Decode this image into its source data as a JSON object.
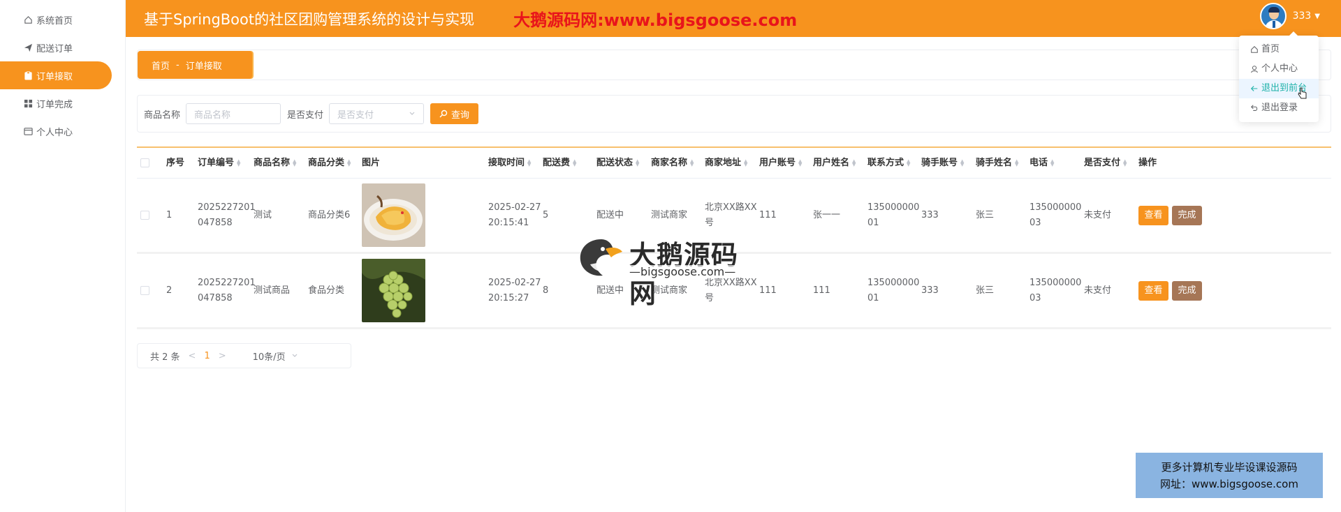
{
  "sidebar": {
    "items": [
      {
        "label": "系统首页",
        "icon": "home-icon"
      },
      {
        "label": "配送订单",
        "icon": "send-icon"
      },
      {
        "label": "订单接取",
        "icon": "clipboard-icon",
        "active": true
      },
      {
        "label": "订单完成",
        "icon": "grid-icon"
      },
      {
        "label": "个人中心",
        "icon": "card-icon"
      }
    ]
  },
  "header": {
    "title": "基于SpringBoot的社区团购管理系统的设计与实现",
    "watermark": "大鹅源码网:www.bigsgoose.com",
    "username": "333"
  },
  "dropdown": {
    "items": [
      "首页",
      "个人中心",
      "退出到前台",
      "退出登录"
    ]
  },
  "breadcrumb": {
    "home": "首页",
    "sep": "-",
    "current": "订单接取"
  },
  "search": {
    "name_label": "商品名称",
    "name_placeholder": "商品名称",
    "paid_label": "是否支付",
    "paid_placeholder": "是否支付",
    "button": "查询"
  },
  "table": {
    "columns": [
      "序号",
      "订单编号",
      "商品名称",
      "商品分类",
      "图片",
      "接取时间",
      "配送费",
      "配送状态",
      "商家名称",
      "商家地址",
      "用户账号",
      "用户姓名",
      "联系方式",
      "骑手账号",
      "骑手姓名",
      "电话",
      "是否支付",
      "操作"
    ],
    "rows": [
      {
        "idx": "1",
        "order_no_a": "2025227201",
        "order_no_b": "047858",
        "name": "测试",
        "category": "商品分类6",
        "image": "pasta-photo",
        "time_a": "2025-02-27",
        "time_b": "20:15:41",
        "fee": "5",
        "status": "配送中",
        "merchant": "测试商家",
        "addr_a": "北京XX路XX",
        "addr_b": "号",
        "user_account": "111",
        "user_name": "张一一",
        "contact_a": "135000000",
        "contact_b": "01",
        "rider_account": "333",
        "rider_name": "张三",
        "phone_a": "135000000",
        "phone_b": "03",
        "paid": "未支付"
      },
      {
        "idx": "2",
        "order_no_a": "2025227201",
        "order_no_b": "047858",
        "name": "测试商品",
        "category": "食品分类",
        "image": "grapes-photo",
        "time_a": "2025-02-27",
        "time_b": "20:15:27",
        "fee": "8",
        "status": "配送中",
        "merchant": "测试商家",
        "addr_a": "北京XX路XX",
        "addr_b": "号",
        "user_account": "111",
        "user_name": "111",
        "contact_a": "135000000",
        "contact_b": "01",
        "rider_account": "333",
        "rider_name": "张三",
        "phone_a": "135000000",
        "phone_b": "03",
        "paid": "未支付"
      }
    ],
    "view_label": "查看",
    "done_label": "完成"
  },
  "pager": {
    "total": "共 2 条",
    "prev": "<",
    "page": "1",
    "next": ">",
    "size": "10条/页"
  },
  "watermark_center": {
    "big": "大鹅源码网",
    "small": "—bigsgoose.com—"
  },
  "adbox": {
    "line1": "更多计算机专业毕设课设源码",
    "line2": "网址：www.bigsgoose.com"
  },
  "colors": {
    "accent": "#f7931e",
    "done_button": "#a67656",
    "watermark_red": "#e8141b"
  }
}
